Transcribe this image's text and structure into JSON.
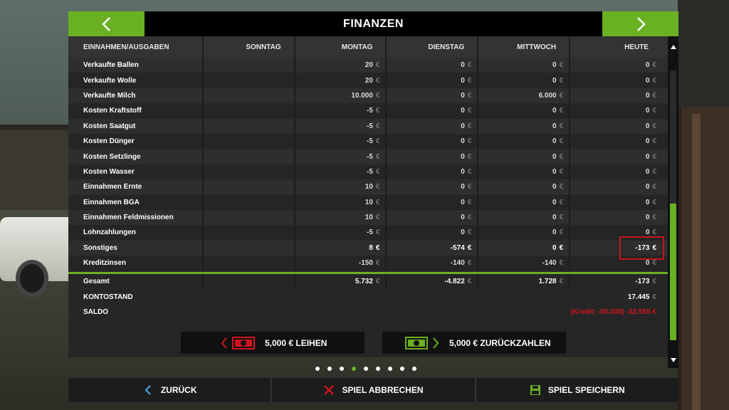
{
  "title": "FINANZEN",
  "columns": [
    "EINNAHMEN/AUSGABEN",
    "SONNTAG",
    "MONTAG",
    "DIENSTAG",
    "MITTWOCH",
    "HEUTE"
  ],
  "currency": "€",
  "rows": [
    {
      "label": "Verkaufte Ballen",
      "values": [
        "",
        "20",
        "0",
        "0",
        "0"
      ]
    },
    {
      "label": "Verkaufte Wolle",
      "values": [
        "",
        "20",
        "0",
        "0",
        "0"
      ]
    },
    {
      "label": "Verkaufte Milch",
      "values": [
        "",
        "10.000",
        "0",
        "6.000",
        "0"
      ]
    },
    {
      "label": "Kosten Kraftstoff",
      "values": [
        "",
        "-5",
        "0",
        "0",
        "0"
      ]
    },
    {
      "label": "Kosten Saatgut",
      "values": [
        "",
        "-5",
        "0",
        "0",
        "0"
      ]
    },
    {
      "label": "Kosten Dünger",
      "values": [
        "",
        "-5",
        "0",
        "0",
        "0"
      ]
    },
    {
      "label": "Kosten Setzlinge",
      "values": [
        "",
        "-5",
        "0",
        "0",
        "0"
      ]
    },
    {
      "label": "Kosten Wasser",
      "values": [
        "",
        "-5",
        "0",
        "0",
        "0"
      ]
    },
    {
      "label": "Einnahmen Ernte",
      "values": [
        "",
        "10",
        "0",
        "0",
        "0"
      ]
    },
    {
      "label": "Einnahmen BGA",
      "values": [
        "",
        "10",
        "0",
        "0",
        "0"
      ]
    },
    {
      "label": "Einnahmen Feldmissionen",
      "values": [
        "",
        "10",
        "0",
        "0",
        "0"
      ]
    },
    {
      "label": "Lohnzahlungen",
      "values": [
        "",
        "-5",
        "0",
        "0",
        "0"
      ]
    },
    {
      "label": "Sonstiges",
      "values": [
        "",
        "8",
        "-574",
        "0",
        "-173"
      ]
    },
    {
      "label": "Kreditzinsen",
      "values": [
        "",
        "-150",
        "-140",
        "-140",
        "0"
      ]
    }
  ],
  "totals": {
    "gesamt_label": "Gesamt",
    "gesamt_values": [
      "",
      "5.732",
      "-4.822",
      "1.728",
      "-173"
    ],
    "kontostand_label": "KONTOSTAND",
    "kontostand_value": "17.445",
    "saldo_label": "SALDO",
    "saldo_value": "(Kredit: -50.000) -32.555 €"
  },
  "actions": {
    "borrow_label": "5,000 € LEIHEN",
    "repay_label": "5,000 € ZURÜCKZAHLEN"
  },
  "pagination": {
    "count": 9,
    "active": 3
  },
  "bottom": {
    "back_label": "ZURÜCK",
    "abort_label": "SPIEL ABBRECHEN",
    "save_label": "SPIEL SPEICHERN"
  },
  "colors": {
    "accent": "#6ab023",
    "danger": "#d0141e",
    "highlight": "#c8141e"
  }
}
